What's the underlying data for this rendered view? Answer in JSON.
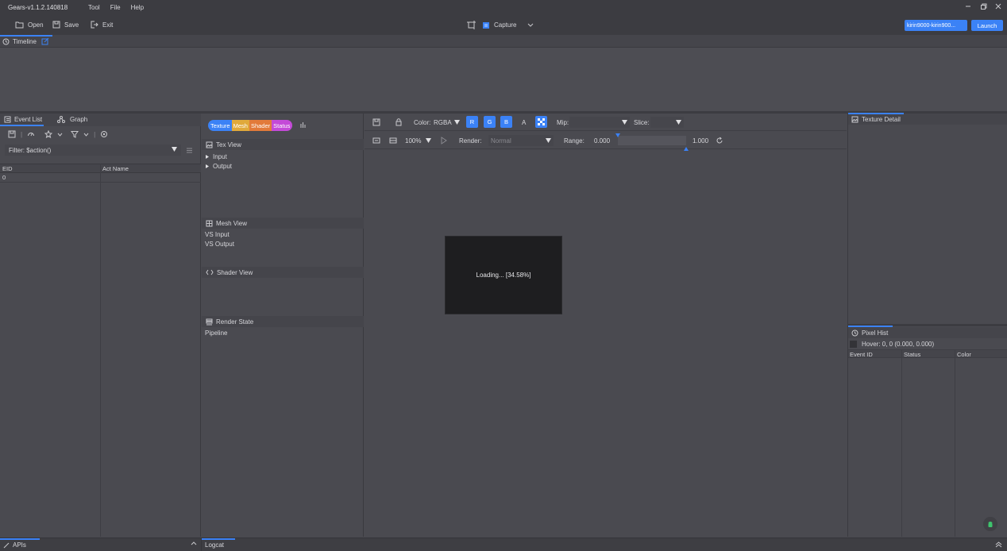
{
  "window": {
    "title": "Gears-v1.1.2.140818"
  },
  "menu": [
    "Tool",
    "File",
    "Help"
  ],
  "toolbar": {
    "open": "Open",
    "save": "Save",
    "exit": "Exit",
    "capture": "Capture",
    "device": "kirin9000-kirin900...",
    "launch": "Launch"
  },
  "timeline": {
    "tab": "Timeline"
  },
  "event_list": {
    "tabs": [
      "Event List",
      "Graph"
    ],
    "filter": "Filter: $action()",
    "columns": [
      "EID",
      "Act Name"
    ],
    "rows": [
      {
        "eid": "0",
        "name": ""
      }
    ]
  },
  "middle": {
    "pills": [
      {
        "label": "Texture",
        "color": "#3b82f6"
      },
      {
        "label": "Mesh",
        "color": "#e0a93b"
      },
      {
        "label": "Shader",
        "color": "#e27a3a"
      },
      {
        "label": "Status",
        "color": "#c44ad8"
      }
    ],
    "tex_view": {
      "title": "Tex View",
      "items": [
        "Input",
        "Output"
      ]
    },
    "mesh_view": {
      "title": "Mesh View",
      "items": [
        "VS Input",
        "VS Output"
      ]
    },
    "shader_view": {
      "title": "Shader View"
    },
    "render_state": {
      "title": "Render State",
      "items": [
        "Pipeline"
      ]
    }
  },
  "texture": {
    "color_label": "Color:",
    "color_value": "RGBA",
    "channels": [
      "R",
      "G",
      "B",
      "A"
    ],
    "mip_label": "Mip:",
    "slice_label": "Slice:",
    "zoom": "100%",
    "render_label": "Render:",
    "render_value": "Normal",
    "range_label": "Range:",
    "range_min": "0.000",
    "range_max": "1.000",
    "loading": "Loading... [34.58%]"
  },
  "right": {
    "texture_detail": "Texture Detail",
    "pixel_hist": "Pixel Hist",
    "hover": "Hover: 0, 0 (0.000, 0.000)",
    "columns": [
      "Event ID",
      "Status",
      "Color"
    ]
  },
  "bottom": {
    "tabs": [
      "APIs",
      "Logcat"
    ]
  },
  "colors": {
    "accent": "#3b82f6",
    "bg": "#4a4a50",
    "panel_header": "#45454b"
  }
}
